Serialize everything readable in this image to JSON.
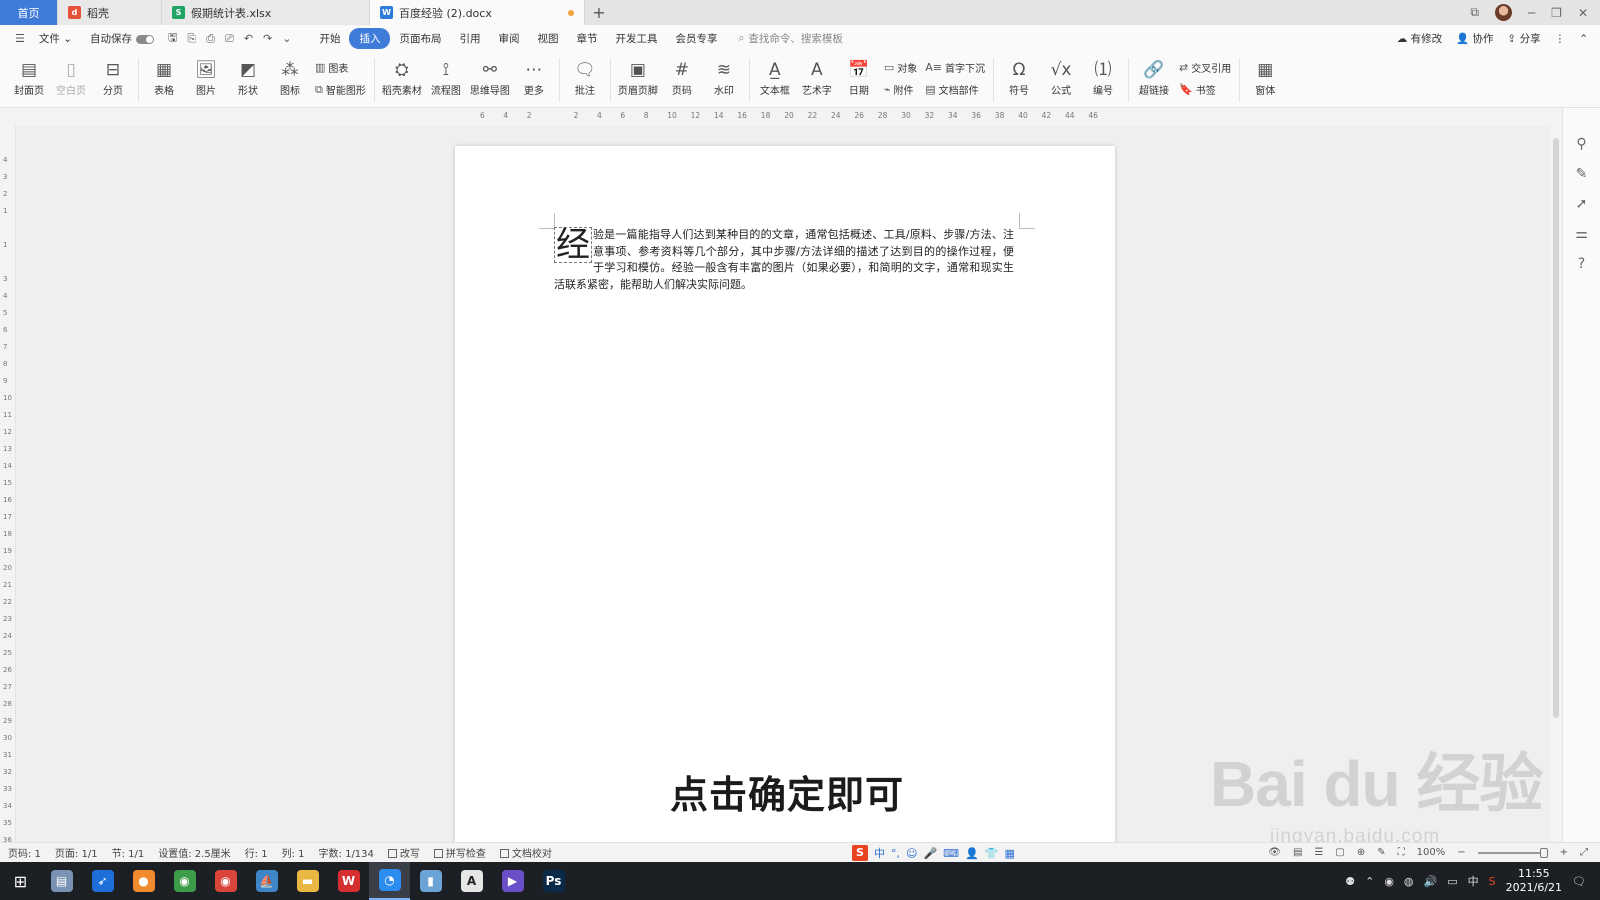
{
  "tabs": [
    {
      "label": "首页",
      "kind": "home"
    },
    {
      "label": "稻壳",
      "kind": "daoke",
      "icon_color": "#e5523a"
    },
    {
      "label": "假期统计表.xlsx",
      "kind": "xlsx",
      "icon_color": "#1fa463"
    },
    {
      "label": "百度经验 (2).docx",
      "kind": "docx",
      "icon_color": "#2f7bd9",
      "active": true
    }
  ],
  "menubar": {
    "file": "文件",
    "autosave": "自动保存",
    "items": [
      "开始",
      "插入",
      "页面布局",
      "引用",
      "审阅",
      "视图",
      "章节",
      "开发工具",
      "会员专享"
    ],
    "active": "插入",
    "search_placeholder": "查找命令、搜索模板",
    "right": [
      "有修改",
      "协作",
      "分享"
    ]
  },
  "ribbon": {
    "cover": "封面页",
    "blank": "空白页",
    "pagebreak": "分页",
    "table": "表格",
    "picture": "图片",
    "shape": "形状",
    "icon": "图标",
    "chart": "图表",
    "smartart": "智能图形",
    "daoke": "稻壳素材",
    "flowchart": "流程图",
    "mindmap": "思维导图",
    "more": "更多",
    "comment": "批注",
    "header_footer": "页眉页脚",
    "pagenum": "页码",
    "watermark": "水印",
    "textbox": "文本框",
    "wordart": "艺术字",
    "date": "日期",
    "object": "对象",
    "attachment": "附件",
    "dropcap": "首字下沉",
    "docparts": "文档部件",
    "symbol": "符号",
    "formula": "公式",
    "numbering": "编号",
    "hyperlink": "超链接",
    "crossref": "交叉引用",
    "bookmark": "书签",
    "window": "窗体"
  },
  "ruler_ticks": [
    "6",
    "4",
    "2",
    "",
    "2",
    "4",
    "6",
    "8",
    "10",
    "12",
    "14",
    "16",
    "18",
    "20",
    "22",
    "24",
    "26",
    "28",
    "30",
    "32",
    "34",
    "36",
    "38",
    "40",
    "42",
    "44",
    "46"
  ],
  "vruler_ticks": [
    "4",
    "3",
    "2",
    "1",
    "",
    "1",
    "",
    "3",
    "4",
    "5",
    "6",
    "7",
    "8",
    "9",
    "10",
    "11",
    "12",
    "13",
    "14",
    "15",
    "16",
    "17",
    "18",
    "19",
    "20",
    "21",
    "22",
    "23",
    "24",
    "25",
    "26",
    "27",
    "28",
    "29",
    "30",
    "31",
    "32",
    "33",
    "34",
    "35",
    "36"
  ],
  "document": {
    "drop_cap": "经",
    "paragraph": "验是一篇能指导人们达到某种目的的文章，通常包括概述、工具/原料、步骤/方法、注意事项、参考资料等几个部分，其中步骤/方法详细的描述了达到目的的操作过程，便于学习和模仿。经验一般含有丰富的图片（如果必要），和简明的文字，通常和现实生活联系紧密，能帮助人们解决实际问题。"
  },
  "subtitle": "点击确定即可",
  "watermark": {
    "main": "Bai du 经验",
    "sub": "jingyan.baidu.com"
  },
  "statusbar": {
    "page_num": "页码: 1",
    "page": "页面: 1/1",
    "section": "节: 1/1",
    "setting": "设置值: 2.5厘米",
    "row": "行: 1",
    "col": "列: 1",
    "words": "字数: 1/134",
    "revise": "改写",
    "spell": "拼写检查",
    "proof": "文档校对",
    "zoom": "100%"
  },
  "ime": {
    "lang": "中"
  },
  "clock": {
    "time": "11:55",
    "date": "2021/6/21"
  },
  "tray_lang": "中",
  "taskbar_apps": [
    {
      "name": "file-icon",
      "color": "#7a93b4",
      "glyph": "▤"
    },
    {
      "name": "feather-icon",
      "color": "#1e6fd9",
      "glyph": "➶"
    },
    {
      "name": "orange-app-icon",
      "color": "#f28a2e",
      "glyph": "●"
    },
    {
      "name": "chrome-icon",
      "color": "#3c9c4a",
      "glyph": "◉"
    },
    {
      "name": "chrome2-icon",
      "color": "#d9453b",
      "glyph": "◉"
    },
    {
      "name": "boat-icon",
      "color": "#3e86c7",
      "glyph": "⛵"
    },
    {
      "name": "folder-icon",
      "color": "#e8b842",
      "glyph": "▬"
    },
    {
      "name": "wps-icon",
      "color": "#d62f2f",
      "glyph": "W"
    },
    {
      "name": "browser-icon",
      "color": "#2d8cf0",
      "glyph": "◔"
    },
    {
      "name": "notes-icon",
      "color": "#6ba3d6",
      "glyph": "▮"
    },
    {
      "name": "app-a-icon",
      "color": "#e6e6e6",
      "glyph": "A"
    },
    {
      "name": "player-icon",
      "color": "#6a4fc9",
      "glyph": "▶"
    },
    {
      "name": "photoshop-icon",
      "color": "#0b2a4a",
      "glyph": "Ps"
    }
  ]
}
